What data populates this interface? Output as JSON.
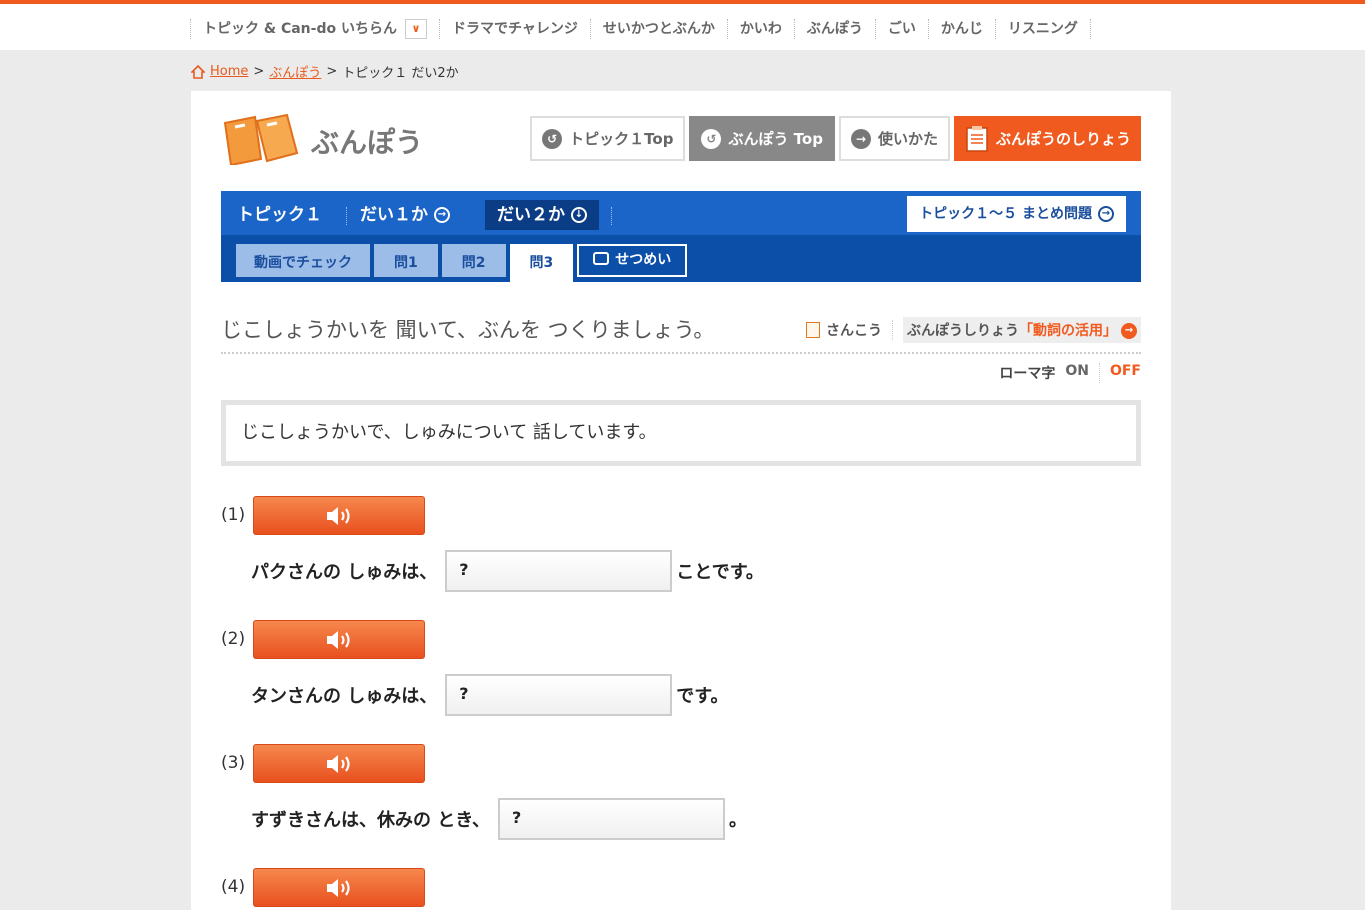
{
  "topnav": {
    "items": [
      "トピック & Can-do いちらん",
      "ドラマでチャレンジ",
      "せいかつとぶんか",
      "かいわ",
      "ぶんぽう",
      "ごい",
      "かんじ",
      "リスニング"
    ]
  },
  "breadcrumb": {
    "home": "Home",
    "sep1": ">",
    "section": "ぶんぽう",
    "sep2": ">",
    "current": "トピック１ だい2か"
  },
  "header": {
    "title": "ぶんぽう",
    "buttons": {
      "topic_top": "トピック１Top",
      "bunpou_top": "ぶんぽう Top",
      "usage": "使いかた",
      "materials": "ぶんぽうのしりょう"
    }
  },
  "lessonbar": {
    "topic": "トピック１",
    "lesson1": "だい１か",
    "lesson2": "だい２か",
    "summary": "トピック１～５ まとめ問題",
    "subtabs": [
      "動画でチェック",
      "問1",
      "問2",
      "問3",
      "せつめい"
    ]
  },
  "instruction": "じこしょうかいを 聞いて、ぶんを つくりましょう。",
  "refs": {
    "sankou": "さんこう",
    "ref_prefix": "ぶんぽうしりょう",
    "ref_highlight": "「動詞の活用」"
  },
  "romaji": {
    "label": "ローマ字",
    "on": "ON",
    "off": "OFF"
  },
  "infobox": "じこしょうかいで、しゅみについて 話しています。",
  "questions": [
    {
      "num": "(1)",
      "before": "パクさんの しゅみは、",
      "blank": "?",
      "after": "ことです。"
    },
    {
      "num": "(2)",
      "before": "タンさんの しゅみは、",
      "blank": "?",
      "after": "です。"
    },
    {
      "num": "(3)",
      "before": "すずきさんは、休みの とき、",
      "blank": "?",
      "after": "。"
    },
    {
      "num": "(4)"
    }
  ],
  "colors": {
    "accent": "#f05a1e",
    "blue": "#1b64c8",
    "navy": "#0b4fa9"
  }
}
